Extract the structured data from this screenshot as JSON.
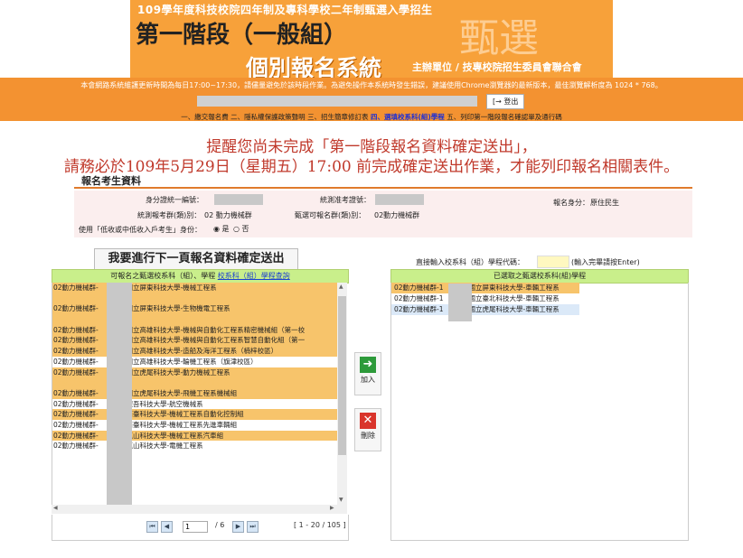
{
  "header": {
    "line1": "109學年度科技校院四年制及專科學校二年制甄選入學招生",
    "line2": "第一階段（一般組）",
    "line3": "個別報名系統",
    "org": "主辦單位 / 技專校院招生委員會聯合會",
    "deco": "甄選",
    "notice": "本會網路系統維護更新時間為每日17:00~17:30，請儘量避免於該時段作業。為避免操作本系統時發生錯誤，建議使用Chrome瀏覽器的最新版本，最佳瀏覽解析度為 1024 * 768。",
    "logout": "登出",
    "nav": {
      "item1": "一、繳交報名費",
      "item2": "二、隱私權保護政策聲明",
      "item3": "三、招生簡章修訂表",
      "item4": "四、選填校系科(組)學程",
      "item5": "五、列印第一階段報名確認單及通行碼"
    }
  },
  "reminder": {
    "line1": "提醒您尚未完成「第一階段報名資料確定送出」，",
    "line2": "請務必於109年5月29日（星期五）17:00 前完成確定送出作業，才能列印報名相關表件。"
  },
  "info": {
    "title": "報名考生資料",
    "id_label": "身分證統一編號：",
    "exam_no_label": "統測准考證號：",
    "identity_label": "報名身分：",
    "identity_value": "原住民生",
    "group_label": "統測報考群(類)別：",
    "group_value": "02 動力機械群",
    "apply_group_label": "甄選可報名群(類)別：",
    "apply_group_value": "02動力機械群",
    "low_income_label": "使用「低收或中低收入戶考生」身份：",
    "yes": "是",
    "no": "否"
  },
  "left": {
    "next_button": "我要進行下一頁報名資料確定送出",
    "head_text": "可報名之甄選校系科（組）、學程",
    "head_link": "校系科（組）學程查詢",
    "rows": [
      {
        "group": "02動力機械群-",
        "school": "-國立屏東科技大學-機械工程系",
        "style": "sel"
      },
      {
        "group": "02動力機械群-",
        "school": "-國立屏東科技大學-機械工程系",
        "style": "faded"
      },
      {
        "group": "02動力機械群-",
        "school": "-國立屏東科技大學-生物機電工程系",
        "style": "sel"
      },
      {
        "group": "02動力機械群-",
        "school": "-國立屏東科技大學-生物機電工程系",
        "style": "faded"
      },
      {
        "group": "02動力機械群-",
        "school": "-國立高雄科技大學-機械與自動化工程系精密機械組（第一校",
        "style": "sel"
      },
      {
        "group": "02動力機械群-",
        "school": "-國立高雄科技大學-機械與自動化工程系智慧自動化組（第一",
        "style": "sel"
      },
      {
        "group": "02動力機械群-",
        "school": "-國立高雄科技大學-造船及海洋工程系（楠梓校區）",
        "style": "sel"
      },
      {
        "group": "02動力機械群-",
        "school": "-國立高雄科技大學-輪機工程系（旗津校區）",
        "style": "plain"
      },
      {
        "group": "02動力機械群-",
        "school": "-國立虎尾科技大學-動力機械工程系",
        "style": "sel"
      },
      {
        "group": "02動力機械群-",
        "school": "-國立虎尾科技大學-動力機械工程系",
        "style": "faded"
      },
      {
        "group": "02動力機械群-",
        "school": "-國立虎尾科技大學-飛機工程系機械組",
        "style": "sel"
      },
      {
        "group": "02動力機械群-",
        "school": "-醒吾科技大學-航空機械系",
        "style": "plain"
      },
      {
        "group": "02動力機械群-",
        "school": "-南臺科技大學-機械工程系自動化控制組",
        "style": "sel"
      },
      {
        "group": "02動力機械群-",
        "school": "-南臺科技大學-機械工程系先進車輛組",
        "style": "plain"
      },
      {
        "group": "02動力機械群-",
        "school": "-崑山科技大學-機械工程系汽車組",
        "style": "sel"
      },
      {
        "group": "02動力機械群-",
        "school": "-崑山科技大學-電機工程系",
        "style": "plain"
      }
    ],
    "pager": {
      "page": "1",
      "total": "/ 6",
      "range": "[ 1 - 20 / 105 ]"
    }
  },
  "actions": {
    "add": "加入",
    "remove": "刪除"
  },
  "right": {
    "code_label": "直接輸入校系科（組）學程代碼：",
    "code_hint": "(輸入完畢請按Enter)",
    "head_text": "已選取之甄選校系科(組)學程",
    "rows": [
      {
        "group": "02動力機械群-1",
        "school": "國立屏東科技大學-車輛工程系",
        "style": "h"
      },
      {
        "group": "02動力機械群-1",
        "school": "國立臺北科技大學-車輛工程系",
        "style": "p"
      },
      {
        "group": "02動力機械群-1",
        "school": "國立虎尾科技大學-車輛工程系",
        "style": "b"
      }
    ]
  },
  "colors": {
    "header_orange": "#f39231",
    "banner_orange": "#f7a13a",
    "reminder_red": "#c0392b",
    "list_highlight": "#f7c46b",
    "panel_head_green": "#c9ef8b",
    "add_green": "#2d9a3a",
    "remove_red": "#d9342b"
  }
}
